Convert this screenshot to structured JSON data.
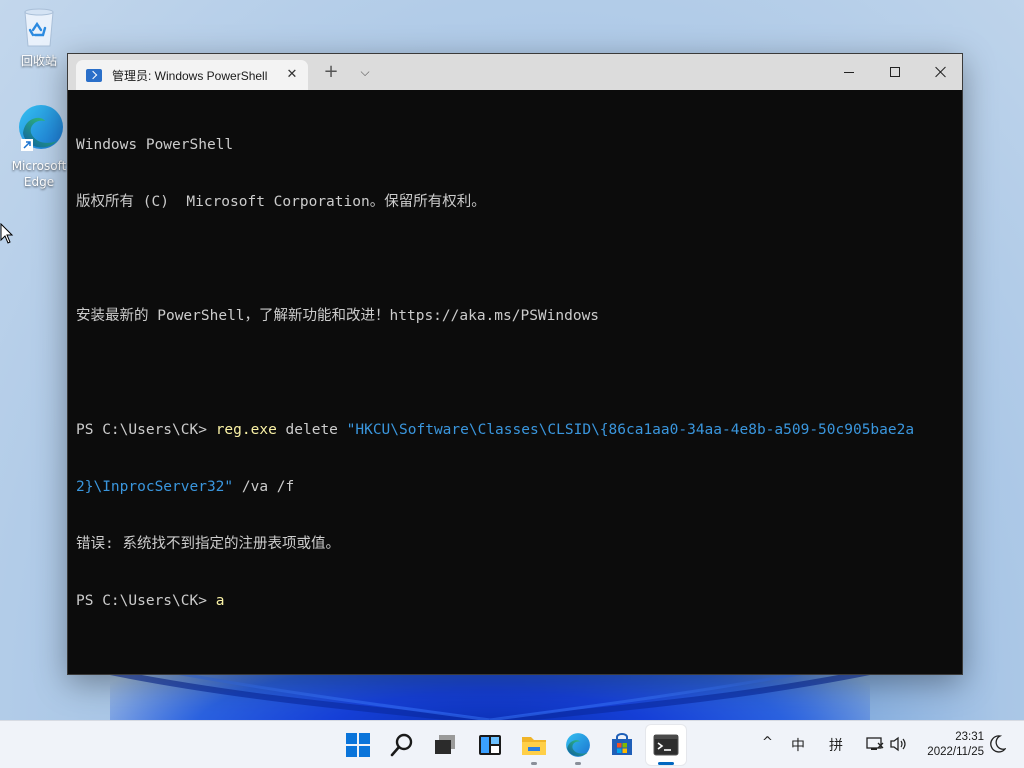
{
  "desktop": {
    "icons": [
      {
        "label": "回收站",
        "icon": "recycle-bin-icon"
      },
      {
        "label": "Microsoft Edge",
        "icon": "edge-icon"
      }
    ]
  },
  "window": {
    "tab_title": "管理员: Windows PowerShell",
    "tab_icon": "powershell-icon",
    "new_tab_glyph": "+",
    "dropdown_glyph": "⌵",
    "close_tab_glyph": "✕"
  },
  "console": {
    "header1": "Windows PowerShell",
    "header2": "版权所有 (C)  Microsoft Corporation。保留所有权利。",
    "header3": "安装最新的 PowerShell，了解新功能和改进！https://aka.ms/PSWindows",
    "prompt": "PS C:\\Users\\CK> ",
    "cmd_name": "reg.exe",
    "cmd_arg": " delete ",
    "cmd_str_part1": "\"HKCU\\Software\\Classes\\CLSID\\{86ca1aa0-34aa-4e8b-a509-50c905bae2a",
    "cmd_str_part2": "2}\\InprocServer32\"",
    "cmd_flags": " /va /f",
    "error": "错误: 系统找不到指定的注册表项或值。",
    "prompt2": "PS C:\\Users\\CK> ",
    "typed": "a",
    "colors": {
      "command": "#f9f1a5",
      "string": "#3a96dd",
      "text": "#cccccc",
      "background": "#0c0c0c"
    }
  },
  "taskbar": {
    "apps": [
      {
        "name": "start",
        "icon": "windows-logo-icon"
      },
      {
        "name": "search",
        "icon": "search-icon"
      },
      {
        "name": "task-view",
        "icon": "task-view-icon"
      },
      {
        "name": "widgets",
        "icon": "widgets-icon"
      },
      {
        "name": "file-explorer",
        "icon": "folder-icon"
      },
      {
        "name": "edge",
        "icon": "edge-icon"
      },
      {
        "name": "store",
        "icon": "store-icon"
      },
      {
        "name": "terminal",
        "icon": "terminal-icon"
      }
    ],
    "tray": {
      "chevron": "^",
      "ime_mode": "中",
      "ime_name": "拼",
      "time": "23:31",
      "date": "2022/11/25"
    }
  }
}
